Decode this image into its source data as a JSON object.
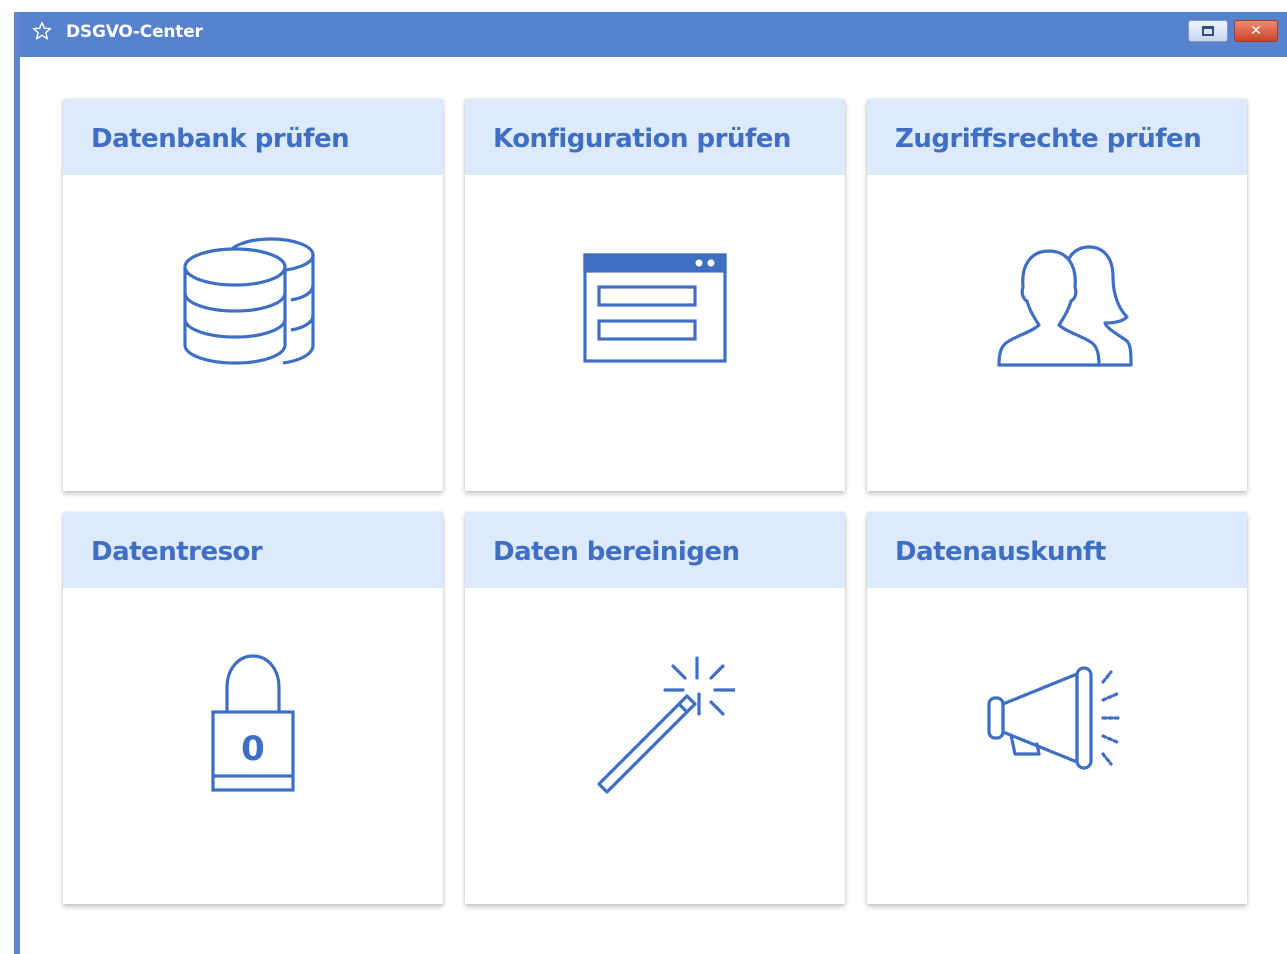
{
  "window": {
    "title": "DSGVO-Center",
    "title_icon": "star-icon",
    "controls": {
      "restore_icon": "restore-icon",
      "close_icon": "close-icon",
      "close_glyph": "✕"
    }
  },
  "colors": {
    "titlebar": "#5681cd",
    "tile_header": "#ddeafb",
    "accent": "#3f6fc4"
  },
  "tiles": [
    {
      "title": "Datenbank prüfen",
      "icon": "database-icon"
    },
    {
      "title": "Konfiguration prüfen",
      "icon": "window-form-icon"
    },
    {
      "title": "Zugriffsrechte prüfen",
      "icon": "users-icon"
    },
    {
      "title": "Datentresor",
      "icon": "padlock-icon",
      "icon_text": "0"
    },
    {
      "title": "Daten bereinigen",
      "icon": "magic-wand-icon"
    },
    {
      "title": "Datenauskunft",
      "icon": "megaphone-icon"
    }
  ]
}
